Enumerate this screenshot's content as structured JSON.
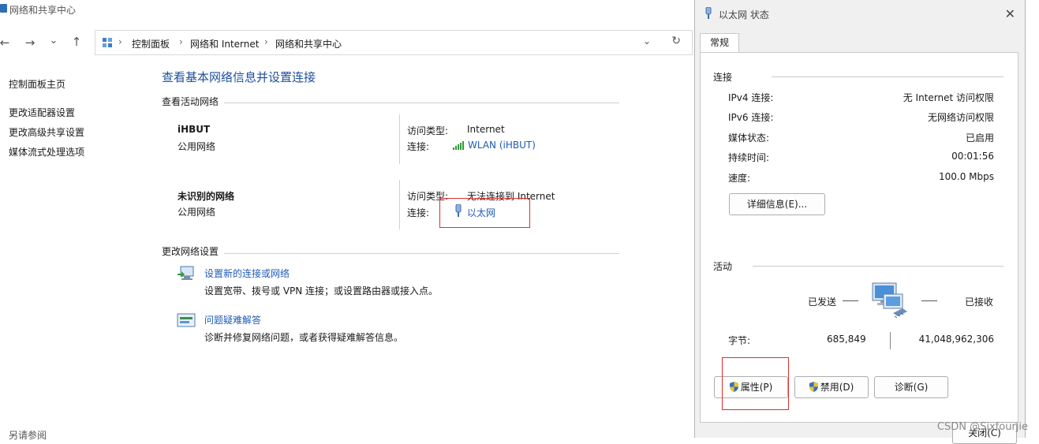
{
  "main": {
    "window_title": "网络和共享中心",
    "nav": {
      "back": "←",
      "forward": "→",
      "recent": "⌄",
      "up": "↑"
    },
    "address": {
      "crumbs": [
        "控制面板",
        "网络和 Internet",
        "网络和共享中心"
      ],
      "separator": "›",
      "dropdown": "⌄",
      "refresh": "↻"
    },
    "sidebar": {
      "home": "控制面板主页",
      "links": [
        "更改适配器设置",
        "更改高级共享设置",
        "媒体流式处理选项"
      ],
      "see_also": "另请参阅"
    },
    "page_title": "查看基本网络信息并设置连接",
    "active_header": "查看活动网络",
    "networks": [
      {
        "name": "iHBUT",
        "type": "公用网络",
        "access_label": "访问类型:",
        "access_value": "Internet",
        "conn_label": "连接:",
        "conn_value": "WLAN (iHBUT)",
        "conn_icon": "wifi-signal-icon"
      },
      {
        "name": "未识别的网络",
        "type": "公用网络",
        "access_label": "访问类型:",
        "access_value": "无法连接到 Internet",
        "conn_label": "连接:",
        "conn_value": "以太网",
        "conn_icon": "ethernet-plug-icon"
      }
    ],
    "change_header": "更改网络设置",
    "tasks": [
      {
        "link": "设置新的连接或网络",
        "desc": "设置宽带、拨号或 VPN 连接；或设置路由器或接入点。",
        "icon": "new-connection-icon"
      },
      {
        "link": "问题疑难解答",
        "desc": "诊断并修复网络问题，或者获得疑难解答信息。",
        "icon": "troubleshoot-icon"
      }
    ]
  },
  "dialog": {
    "title": "以太网 状态",
    "close": "✕",
    "tab": "常规",
    "connection": {
      "header": "连接",
      "rows": [
        {
          "label": "IPv4 连接:",
          "value": "无 Internet 访问权限"
        },
        {
          "label": "IPv6 连接:",
          "value": "无网络访问权限"
        },
        {
          "label": "媒体状态:",
          "value": "已启用"
        },
        {
          "label": "持续时间:",
          "value": "00:01:56"
        },
        {
          "label": "速度:",
          "value": "100.0 Mbps"
        }
      ],
      "details_button": "详细信息(E)..."
    },
    "activity": {
      "header": "活动",
      "sent_label": "已发送",
      "received_label": "已接收",
      "bytes_label": "字节:",
      "sent_bytes": "685,849",
      "received_bytes": "41,048,962,306"
    },
    "buttons": {
      "properties": "属性(P)",
      "disable": "禁用(D)",
      "diagnose": "诊断(G)",
      "close": "关闭(C)"
    }
  },
  "watermark": "CSDN @Sixfourjie",
  "colors": {
    "link": "#1e5bb8",
    "title": "#1e4f9a",
    "highlight": "#d9312f"
  }
}
